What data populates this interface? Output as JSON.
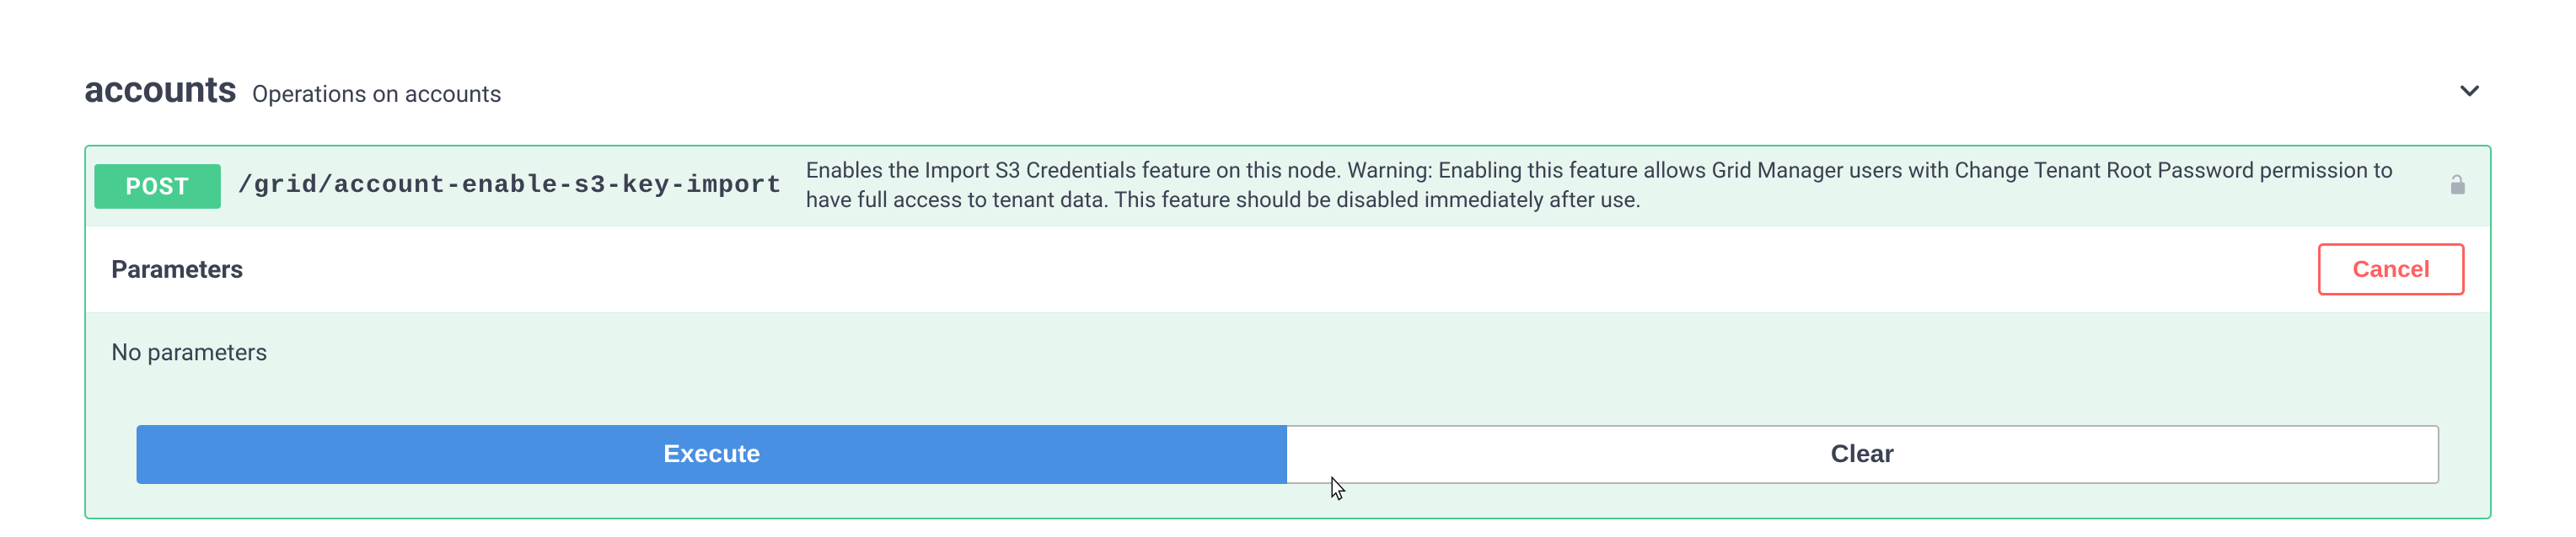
{
  "section": {
    "title": "accounts",
    "subtitle": "Operations on accounts"
  },
  "operation": {
    "method": "POST",
    "path": "/grid/account-enable-s3-key-import",
    "description": "Enables the Import S3 Credentials feature on this node. Warning: Enabling this feature allows Grid Manager users with Change Tenant Root Password permission to have full access to tenant data. This feature should be disabled immediately after use."
  },
  "parameters": {
    "title": "Parameters",
    "cancel_label": "Cancel",
    "empty_text": "No parameters"
  },
  "actions": {
    "execute_label": "Execute",
    "clear_label": "Clear"
  }
}
